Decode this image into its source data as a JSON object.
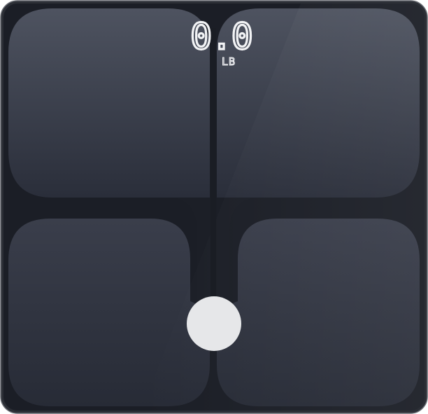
{
  "display": {
    "weight_value": "0.0",
    "unit": "LB"
  },
  "colors": {
    "frame": "#1b1e26",
    "pad_top": "#4d525f",
    "pad_bottom": "#2a2e39",
    "sensor": "#e6e7e9"
  }
}
